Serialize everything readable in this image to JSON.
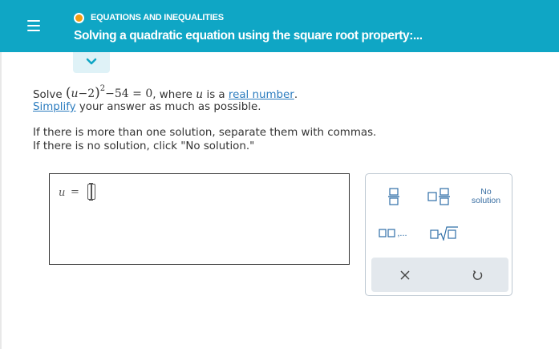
{
  "header": {
    "menu_icon": "hamburger-menu-icon",
    "topic": "EQUATIONS AND INEQUALITIES",
    "topic_status_color": "#f39c12",
    "title": "Solving a quadratic equation using the square root property:...",
    "background_color": "#0fa6c5"
  },
  "expand": {
    "icon": "chevron-down-icon"
  },
  "problem": {
    "solve_word": "Solve",
    "equation_var": "u",
    "equation_minus2": "−2",
    "equation_exponent": "2",
    "equation_rest": "−54 = 0",
    "where_text": ", where",
    "where_var": "u",
    "is_a_text": "is a",
    "real_number_link": "real number",
    "period": ".",
    "simplify_link": "Simplify",
    "simplify_rest": "your answer as much as possible."
  },
  "instructions": {
    "line1": "If there is more than one solution, separate them with commas.",
    "line2": "If there is no solution, click \"No solution.\""
  },
  "answer": {
    "variable": "u",
    "equals": "=",
    "value": ""
  },
  "keypad": {
    "fraction_icon": "fraction-icon",
    "mixed_number_icon": "mixed-number-icon",
    "no_solution_line1": "No",
    "no_solution_line2": "solution",
    "list_icon": "list-comma-icon",
    "list_label": ",...",
    "sqrt_icon": "square-root-icon",
    "clear_icon": "clear-x-icon",
    "undo_icon": "undo-icon"
  }
}
